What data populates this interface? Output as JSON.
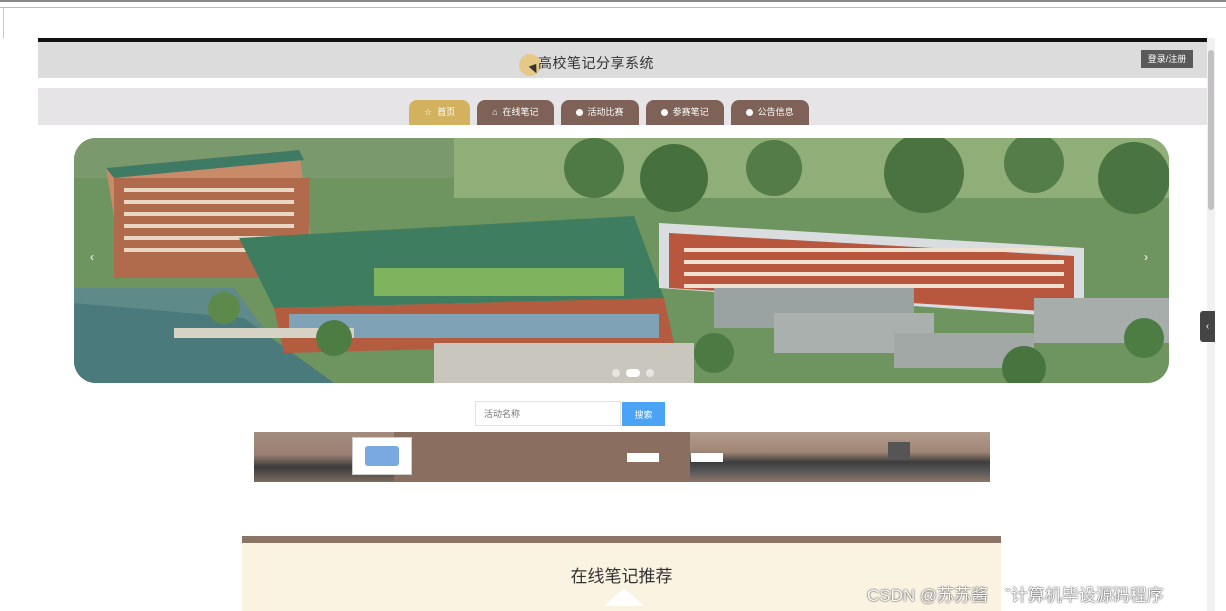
{
  "header": {
    "site_title": "高校笔记分享系统",
    "login_label": "登录/注册"
  },
  "nav": {
    "items": [
      {
        "label": "首页",
        "icon": "star-icon",
        "active": true
      },
      {
        "label": "在线笔记",
        "icon": "home-icon",
        "active": false
      },
      {
        "label": "活动比赛",
        "icon": "dot-icon",
        "active": false
      },
      {
        "label": "参赛笔记",
        "icon": "dot-icon",
        "active": false
      },
      {
        "label": "公告信息",
        "icon": "dot-icon",
        "active": false
      }
    ],
    "active_color": "#d2b15f",
    "inactive_color": "#7e6257"
  },
  "banner": {
    "prev_glyph": "‹",
    "next_glyph": "›",
    "slide_count": 3,
    "active_slide": 1
  },
  "search": {
    "placeholder": "活动名称",
    "button_label": "搜索"
  },
  "recommend": {
    "title": "在线笔记推荐"
  },
  "side_tab": {
    "glyph": "‹"
  },
  "watermark": "CSDN @苏苏酱　ˇ计算机毕设源码程序"
}
